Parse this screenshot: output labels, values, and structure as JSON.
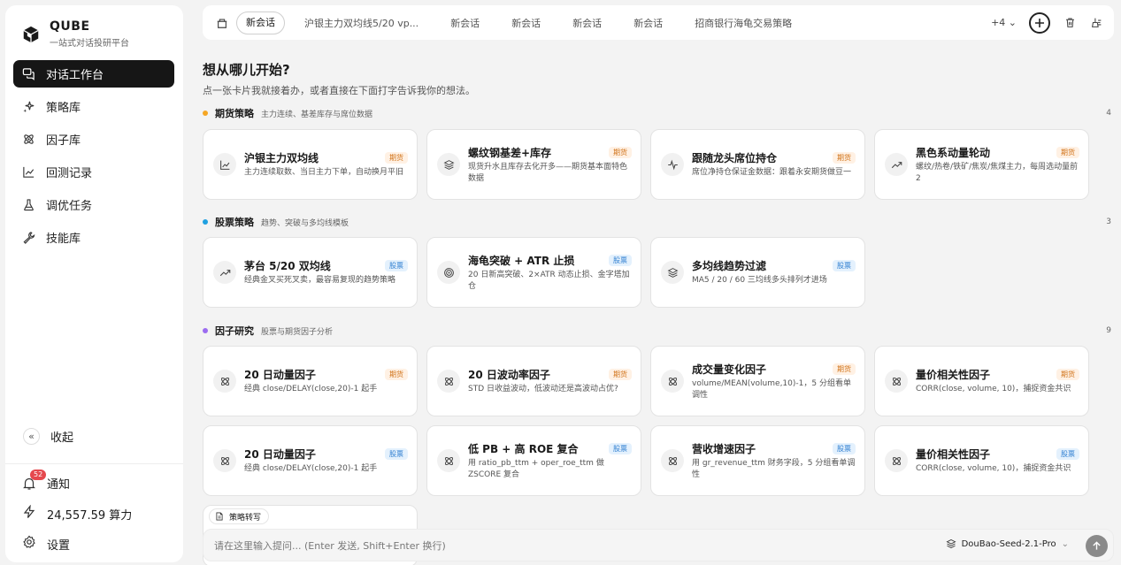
{
  "brand": {
    "name": "QUBE",
    "subtitle": "一站式对话投研平台"
  },
  "nav": [
    {
      "label": "对话工作台",
      "icon": "chat-icon",
      "active": true
    },
    {
      "label": "策略库",
      "icon": "sparkles-icon"
    },
    {
      "label": "因子库",
      "icon": "atom-icon"
    },
    {
      "label": "回测记录",
      "icon": "line-chart-icon"
    },
    {
      "label": "调优任务",
      "icon": "flask-icon"
    },
    {
      "label": "技能库",
      "icon": "wrench-icon"
    }
  ],
  "sidebar_bottom": {
    "collapse_label": "收起",
    "notify_label": "通知",
    "notify_count": "52",
    "compute_label": "24,557.59 算力",
    "settings_label": "设置"
  },
  "tabs": [
    {
      "label": "新会话",
      "active": true
    },
    {
      "label": "沪银主力双均线5/20 vp..."
    },
    {
      "label": "新会话"
    },
    {
      "label": "新会话"
    },
    {
      "label": "新会话"
    },
    {
      "label": "新会话"
    },
    {
      "label": "招商银行海龟交易策略"
    }
  ],
  "tabs_more": "+4",
  "main": {
    "title": "想从哪儿开始?",
    "subtitle": "点一张卡片我就接着办，或者直接在下面打字告诉我你的想法。"
  },
  "colors": {
    "futures_dot": "#f5a623",
    "stock_dot": "#1fa0e0",
    "factor_dot": "#9b6cf0"
  },
  "sections": [
    {
      "title": "期货策略",
      "desc": "主力连续、基差库存与席位数据",
      "count": "4",
      "cards": [
        {
          "title": "沪银主力双均线",
          "desc": "主力连续取数、当日主力下单，自动换月平旧",
          "tag": "期货",
          "icon": "line-chart-icon"
        },
        {
          "title": "螺纹钢基差+库存",
          "desc": "现货升水且库存去化开多——期货基本面特色数据",
          "tag": "期货",
          "icon": "layers-icon"
        },
        {
          "title": "跟随龙头席位持仓",
          "desc": "席位净持仓保证金数据：跟着永安期货做豆一",
          "tag": "期货",
          "icon": "pulse-icon"
        },
        {
          "title": "黑色系动量轮动",
          "desc": "螺纹/热卷/铁矿/焦炭/焦煤主力，每周选动量前 2",
          "tag": "期货",
          "icon": "trend-up-icon"
        }
      ]
    },
    {
      "title": "股票策略",
      "desc": "趋势、突破与多均线模板",
      "count": "3",
      "cards": [
        {
          "title": "茅台 5/20 双均线",
          "desc": "经典金叉买死叉卖，最容易复现的趋势策略",
          "tag": "股票",
          "icon": "trend-up-icon"
        },
        {
          "title": "海龟突破 + ATR 止损",
          "desc": "20 日新高突破、2×ATR 动态止损、金字塔加仓",
          "tag": "股票",
          "icon": "target-icon"
        },
        {
          "title": "多均线趋势过滤",
          "desc": "MA5 / 20 / 60 三均线多头排列才进场",
          "tag": "股票",
          "icon": "layers-icon"
        }
      ]
    },
    {
      "title": "因子研究",
      "desc": "股票与期货因子分析",
      "count": "9",
      "cards": [
        {
          "title": "20 日动量因子",
          "desc": "经典 close/DELAY(close,20)-1 起手",
          "tag": "期货",
          "icon": "atom-icon"
        },
        {
          "title": "20 日波动率因子",
          "desc": "STD 日收益波动，低波动还是高波动占优?",
          "tag": "期货",
          "icon": "atom-icon"
        },
        {
          "title": "成交量变化因子",
          "desc": "volume/MEAN(volume,10)-1，5 分组看单调性",
          "tag": "期货",
          "icon": "atom-icon"
        },
        {
          "title": "量价相关性因子",
          "desc": "CORR(close, volume, 10)，捕捉资金共识",
          "tag": "期货",
          "icon": "atom-icon"
        },
        {
          "title": "20 日动量因子",
          "desc": "经典 close/DELAY(close,20)-1 起手",
          "tag": "股票",
          "icon": "atom-icon"
        },
        {
          "title": "低 PB + 高 ROE 复合",
          "desc": "用 ratio_pb_ttm + oper_roe_ttm 做 ZSCORE 复合",
          "tag": "股票",
          "icon": "atom-icon"
        },
        {
          "title": "营收增速因子",
          "desc": "用 gr_revenue_ttm 财务字段，5 分组看单调性",
          "tag": "股票",
          "icon": "atom-icon"
        },
        {
          "title": "量价相关性因子",
          "desc": "CORR(close, volume, 10)，捕捉资金共识",
          "tag": "股票",
          "icon": "atom-icon"
        }
      ]
    }
  ],
  "partial_chip": "策略转写",
  "input": {
    "placeholder": "请在这里输入提问... (Enter 发送, Shift+Enter 换行)",
    "model": "DouBao-Seed-2.1-Pro"
  }
}
